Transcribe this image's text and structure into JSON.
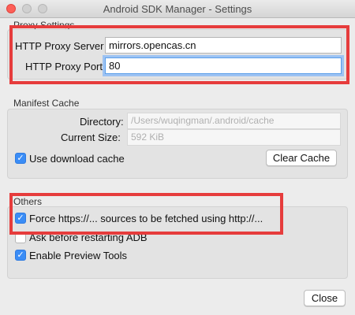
{
  "window": {
    "title": "Android SDK Manager - Settings"
  },
  "proxy": {
    "section_title": "Proxy Settings",
    "server_label": "HTTP Proxy Server",
    "server_value": "mirrors.opencas.cn",
    "port_label": "HTTP Proxy Port",
    "port_value": "80"
  },
  "manifest": {
    "section_title": "Manifest Cache",
    "directory_label": "Directory:",
    "directory_value": "/Users/wuqingman/.android/cache",
    "size_label": "Current Size:",
    "size_value": "592 KiB",
    "use_cache_label": "Use download cache",
    "use_cache_checked": true,
    "clear_button": "Clear Cache"
  },
  "others": {
    "section_title": "Others",
    "force_https_label": "Force https://... sources to be fetched using http://...",
    "force_https_checked": true,
    "ask_adb_label": "Ask before restarting ADB",
    "ask_adb_checked": false,
    "preview_label": "Enable Preview Tools",
    "preview_checked": true
  },
  "footer": {
    "close_button": "Close"
  },
  "annotation_color": "#e63c3c"
}
